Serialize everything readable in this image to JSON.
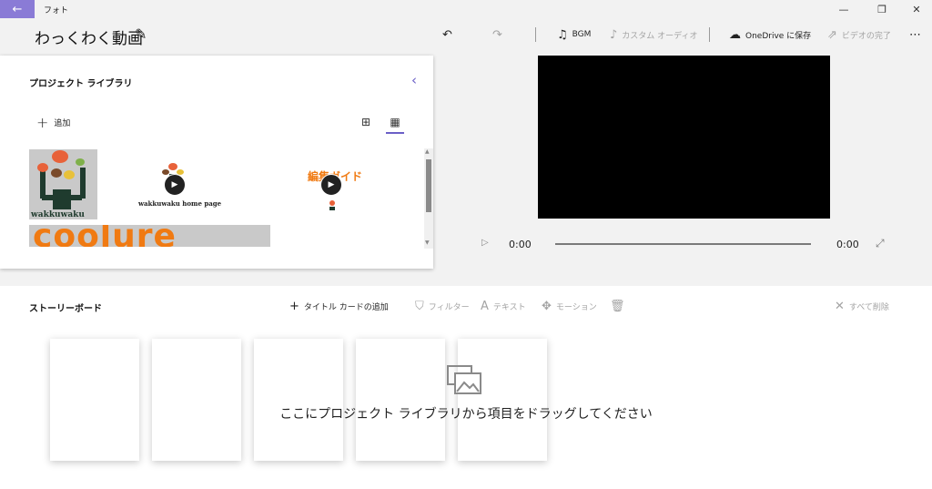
{
  "titlebar": {
    "app_name": "フォト",
    "back_icon": "arrow-left-icon",
    "accent": "#8a7bd6"
  },
  "header": {
    "project_title": "わっくわく動画",
    "toolbar": {
      "bgm": "BGM",
      "custom_audio": "カスタム オーディオ",
      "save_onedrive": "OneDrive に保存",
      "finish_video": "ビデオの完了"
    }
  },
  "library": {
    "title": "プロジェクト ライブラリ",
    "add_label": "追加",
    "items": [
      {
        "label": "wakkuwaku",
        "type": "image"
      },
      {
        "label": "wakkuwaku home page",
        "type": "video"
      },
      {
        "label": "編集ガイド",
        "type": "video"
      },
      {
        "label": "coolure",
        "type": "image"
      }
    ]
  },
  "player": {
    "current_time": "0:00",
    "total_time": "0:00",
    "progress": 0
  },
  "storyboard": {
    "title": "ストーリーボード",
    "add_title_card": "タイトル カードの追加",
    "filter": "フィルター",
    "text": "テキスト",
    "motion": "モーション",
    "remove_all": "すべて削除",
    "drop_hint": "ここにプロジェクト ライブラリから項目をドラッグしてください"
  },
  "colors": {
    "accent": "#6b5fc7",
    "orange": "#f07a12",
    "disabled": "#a3a3a3"
  }
}
